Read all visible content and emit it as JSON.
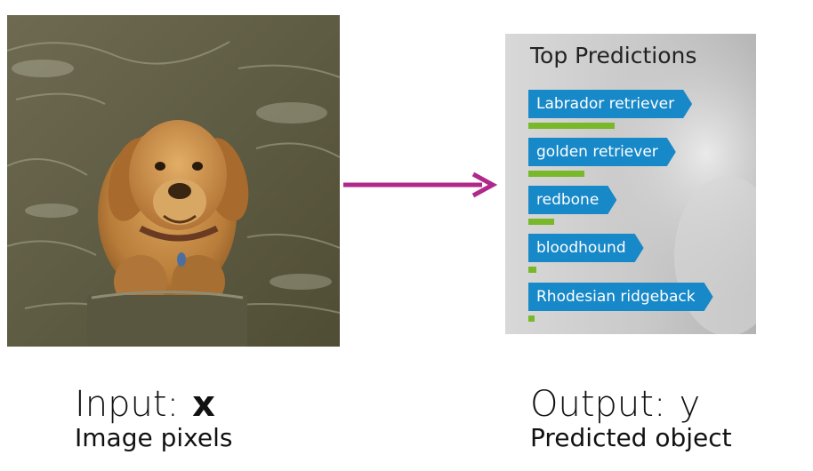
{
  "predictions_panel": {
    "title": "Top Predictions",
    "tag_color": "#1788c8",
    "bar_color": "#79b82a",
    "items": [
      {
        "label": "Labrador retriever",
        "score": 0.43
      },
      {
        "label": "golden retriever",
        "score": 0.28
      },
      {
        "label": "redbone",
        "score": 0.13
      },
      {
        "label": "bloodhound",
        "score": 0.04
      },
      {
        "label": "Rhodesian ridgeback",
        "score": 0.03
      }
    ]
  },
  "input_caption": {
    "label": "Input:",
    "variable": "x",
    "description": "Image pixels"
  },
  "output_caption": {
    "label": "Output:",
    "variable": "y",
    "description": "Predicted object"
  },
  "arrow_color": "#b0288a",
  "image_subject": "dog-in-water"
}
